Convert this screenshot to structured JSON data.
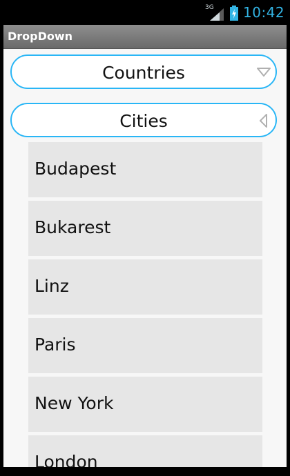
{
  "status_bar": {
    "network_type": "3G",
    "time": "10:42",
    "clock_color": "#33b5e5"
  },
  "app": {
    "title": "DropDown"
  },
  "spinners": {
    "countries": {
      "label": "Countries",
      "state": "collapsed",
      "arrow_icon": "triangle-down-icon"
    },
    "cities": {
      "label": "Cities",
      "state": "expanded",
      "arrow_icon": "triangle-left-icon"
    }
  },
  "city_list": {
    "items": [
      {
        "label": "Budapest"
      },
      {
        "label": "Bukarest"
      },
      {
        "label": "Linz"
      },
      {
        "label": "Paris"
      },
      {
        "label": "New York"
      },
      {
        "label": "London"
      }
    ]
  },
  "colors": {
    "accent": "#29b6f6",
    "list_item_bg": "#e6e6e6",
    "content_bg": "#f7f7f7",
    "title_bar_bg": "#7a7a7a"
  }
}
